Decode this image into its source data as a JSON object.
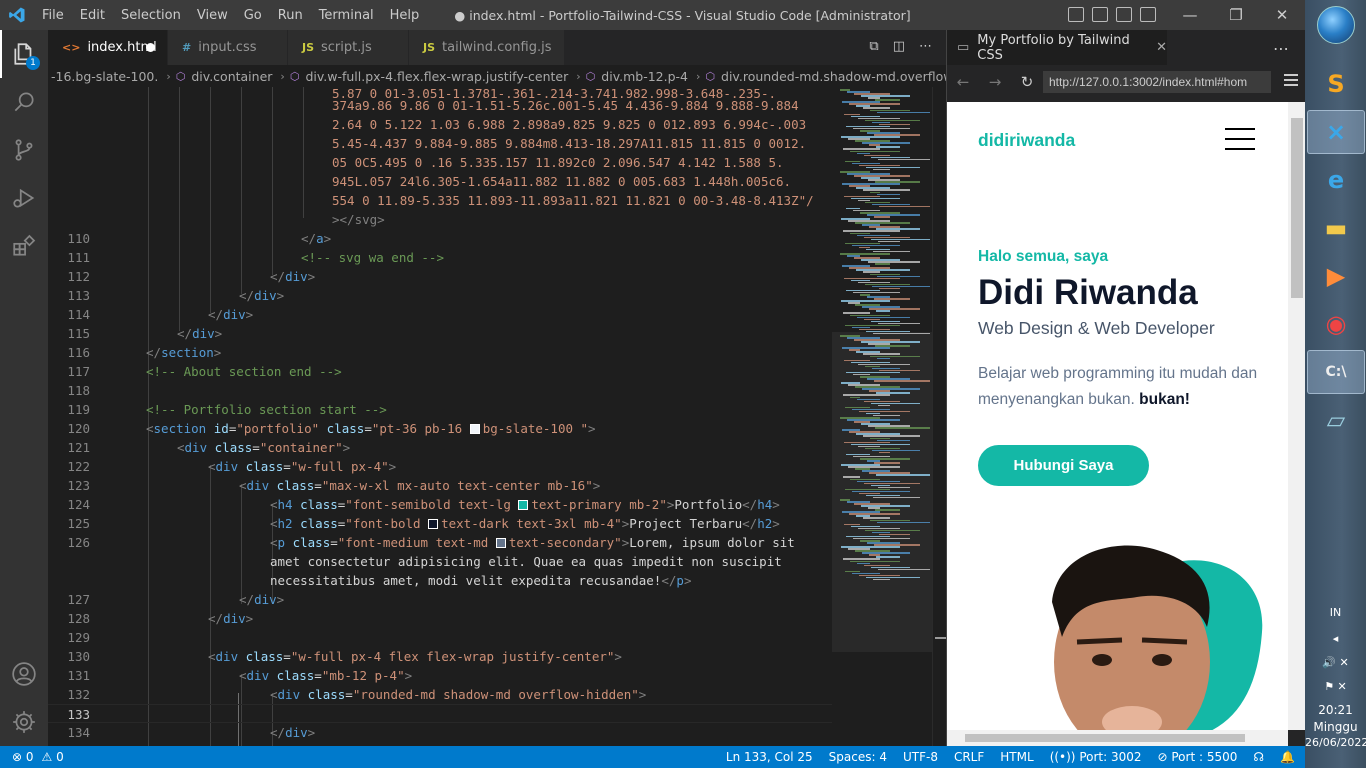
{
  "titlebar": {
    "menu": [
      "File",
      "Edit",
      "Selection",
      "View",
      "Go",
      "Run",
      "Terminal",
      "Help"
    ],
    "title": "● index.html - Portfolio-Tailwind-CSS - Visual Studio Code [Administrator]",
    "buttons": {
      "minimize": "—",
      "restore": "❐",
      "close": "✕"
    }
  },
  "activity": {
    "explorer_badge": "1"
  },
  "tabs": [
    {
      "icon": "<>",
      "label": "index.html",
      "icon_color": "#e37933"
    },
    {
      "icon": "#",
      "label": "input.css",
      "icon_color": "#519aba"
    },
    {
      "icon": "JS",
      "label": "script.js",
      "icon_color": "#cbcb41"
    },
    {
      "icon": "JS",
      "label": "tailwind.config.js",
      "icon_color": "#cbcb41"
    }
  ],
  "editor_actions": [
    "⧉",
    "◫",
    "⋯"
  ],
  "breadcrumb": [
    "-16.bg-slate-100.",
    "div.container",
    "div.w-full.px-4.flex.flex-wrap.justify-center",
    "div.mb-12.p-4",
    "div.rounded-md.shadow-md.overflow-hidden"
  ],
  "wrapped_top": [
    "5.87 0 01-3.051-1.3781-.361-.214-3.741.982.998-3.648-.235-.",
    "374a9.86 9.86 0 01-1.51-5.26c.001-5.45 4.436-9.884 9.888-9.884",
    "2.64 0 5.122 1.03 6.988 2.898a9.825 9.825 0 012.893 6.994c-.003",
    "5.45-4.437 9.884-9.885 9.884m8.413-18.297A11.815 11.815 0 0012.",
    "05 0C5.495 0 .16 5.335.157 11.892c0 2.096.547 4.142 1.588 5.",
    "945L.057 24l6.305-1.654a11.882 11.882 0 005.683 1.448h.005c6.",
    "554 0 11.89-5.335 11.893-11.893a11.821 11.821 0 00-3.48-8.413Z\"/",
    "></svg>"
  ],
  "code_lines": {
    "l110": "110",
    "l111": "111",
    "l112": "112",
    "l113": "113",
    "l114": "114",
    "l115": "115",
    "l116": "116",
    "l117": "117",
    "l118": "118",
    "l119": "119",
    "l120": "120",
    "l121": "121",
    "l122": "122",
    "l123": "123",
    "l124": "124",
    "l125": "125",
    "l126": "126",
    "l127": "127",
    "l128": "128",
    "l129": "129",
    "l130": "130",
    "l131": "131",
    "l132": "132",
    "l133": "133",
    "l134": "134",
    "c111": "<!-- svg wa end -->",
    "c117": "<!-- About section end -->",
    "c119": "<!-- Portfolio section start -->",
    "id_val": "\"portfolio\"",
    "class120": "\"pt-36 pb-16 ",
    "class120b": "bg-slate-100 \"",
    "class121": "\"container\"",
    "class122": "\"w-full px-4\"",
    "class123": "\"max-w-xl mx-auto text-center mb-16\"",
    "class124a": "\"font-semibold text-lg ",
    "class124b": "text-primary mb-2\"",
    "text124": "Portfolio",
    "class125a": "\"font-bold ",
    "class125b": "text-dark text-3xl mb-4\"",
    "text125": "Project Terbaru",
    "class126a": "\"font-medium text-md ",
    "class126b": "text-secondary\"",
    "text126a": "Lorem, ipsum dolor sit",
    "text126b": "amet consectetur adipisicing elit. Quae ea quas impedit non suscipit",
    "text126c": "necessitatibus amet, modi velit expedita recusandae!",
    "class130": "\"w-full px-4 flex flex-wrap justify-center\"",
    "class131": "\"mb-12 p-4\"",
    "class132": "\"rounded-md shadow-md overflow-hidden\""
  },
  "swatches": {
    "slate100": "#f1f5f9",
    "primary": "#14b8a6",
    "dark": "#0f172a",
    "secondary": "#64748b"
  },
  "preview": {
    "tab_title": "My Portfolio by Tailwind CSS",
    "url": "http://127.0.0.1:3002/index.html#hom",
    "page": {
      "brand": "didiriwanda",
      "hello": "Halo semua, saya",
      "name": "Didi Riwanda",
      "role": "Web Design & Web Developer",
      "desc": "Belajar web programming itu mudah dan menyenangkan bukan.",
      "desc_bold": "bukan!",
      "cta": "Hubungi Saya"
    }
  },
  "status": {
    "errors": "⊗ 0",
    "warnings": "⚠ 0",
    "position": "Ln 133, Col 25",
    "spaces": "Spaces: 4",
    "encoding": "UTF-8",
    "eol": "CRLF",
    "language": "HTML",
    "port1": "Port: 3002",
    "port2": "Port : 5500"
  },
  "taskbar": {
    "lang": "IN",
    "time": "20:21",
    "day": "Minggu",
    "date": "26/06/2022"
  },
  "colors": {
    "accent": "#007acc",
    "teal": "#14b8a6"
  }
}
